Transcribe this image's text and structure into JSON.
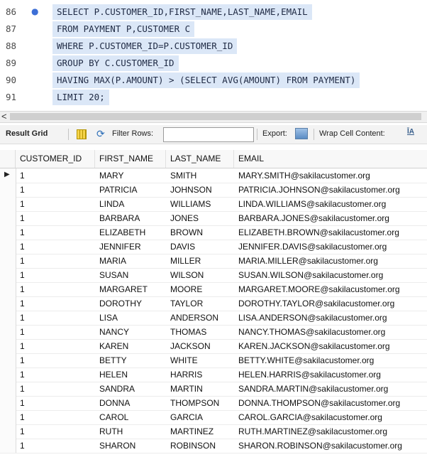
{
  "editor": {
    "lines": [
      {
        "num": "86",
        "code": "SELECT P.CUSTOMER_ID,FIRST_NAME,LAST_NAME,EMAIL",
        "marker": "●"
      },
      {
        "num": "87",
        "code": "FROM PAYMENT P,CUSTOMER C"
      },
      {
        "num": "88",
        "code": "WHERE P.CUSTOMER_ID=P.CUSTOMER_ID"
      },
      {
        "num": "89",
        "code": "GROUP BY C.CUSTOMER_ID"
      },
      {
        "num": "90",
        "code": "HAVING MAX(P.AMOUNT) > (SELECT AVG(AMOUNT) FROM PAYMENT)"
      },
      {
        "num": "91",
        "code": "LIMIT 20;"
      }
    ],
    "scroll_left_glyph": "<"
  },
  "toolbar": {
    "result_grid": "Result Grid",
    "filter_rows": "Filter Rows:",
    "export": "Export:",
    "wrap_cell": "Wrap Cell Content:",
    "wrap_glyph": "ĪA",
    "filter_value": ""
  },
  "grid": {
    "columns": [
      "CUSTOMER_ID",
      "FIRST_NAME",
      "LAST_NAME",
      "EMAIL"
    ],
    "current_row_marker": "▶",
    "rows": [
      [
        "1",
        "MARY",
        "SMITH",
        "MARY.SMITH@sakilacustomer.org"
      ],
      [
        "1",
        "PATRICIA",
        "JOHNSON",
        "PATRICIA.JOHNSON@sakilacustomer.org"
      ],
      [
        "1",
        "LINDA",
        "WILLIAMS",
        "LINDA.WILLIAMS@sakilacustomer.org"
      ],
      [
        "1",
        "BARBARA",
        "JONES",
        "BARBARA.JONES@sakilacustomer.org"
      ],
      [
        "1",
        "ELIZABETH",
        "BROWN",
        "ELIZABETH.BROWN@sakilacustomer.org"
      ],
      [
        "1",
        "JENNIFER",
        "DAVIS",
        "JENNIFER.DAVIS@sakilacustomer.org"
      ],
      [
        "1",
        "MARIA",
        "MILLER",
        "MARIA.MILLER@sakilacustomer.org"
      ],
      [
        "1",
        "SUSAN",
        "WILSON",
        "SUSAN.WILSON@sakilacustomer.org"
      ],
      [
        "1",
        "MARGARET",
        "MOORE",
        "MARGARET.MOORE@sakilacustomer.org"
      ],
      [
        "1",
        "DOROTHY",
        "TAYLOR",
        "DOROTHY.TAYLOR@sakilacustomer.org"
      ],
      [
        "1",
        "LISA",
        "ANDERSON",
        "LISA.ANDERSON@sakilacustomer.org"
      ],
      [
        "1",
        "NANCY",
        "THOMAS",
        "NANCY.THOMAS@sakilacustomer.org"
      ],
      [
        "1",
        "KAREN",
        "JACKSON",
        "KAREN.JACKSON@sakilacustomer.org"
      ],
      [
        "1",
        "BETTY",
        "WHITE",
        "BETTY.WHITE@sakilacustomer.org"
      ],
      [
        "1",
        "HELEN",
        "HARRIS",
        "HELEN.HARRIS@sakilacustomer.org"
      ],
      [
        "1",
        "SANDRA",
        "MARTIN",
        "SANDRA.MARTIN@sakilacustomer.org"
      ],
      [
        "1",
        "DONNA",
        "THOMPSON",
        "DONNA.THOMPSON@sakilacustomer.org"
      ],
      [
        "1",
        "CAROL",
        "GARCIA",
        "CAROL.GARCIA@sakilacustomer.org"
      ],
      [
        "1",
        "RUTH",
        "MARTINEZ",
        "RUTH.MARTINEZ@sakilacustomer.org"
      ],
      [
        "1",
        "SHARON",
        "ROBINSON",
        "SHARON.ROBINSON@sakilacustomer.org"
      ]
    ]
  },
  "colors": {
    "selection": "#dbe7f7",
    "keyword": "#3d6fd6",
    "text": "#1f2a44"
  }
}
